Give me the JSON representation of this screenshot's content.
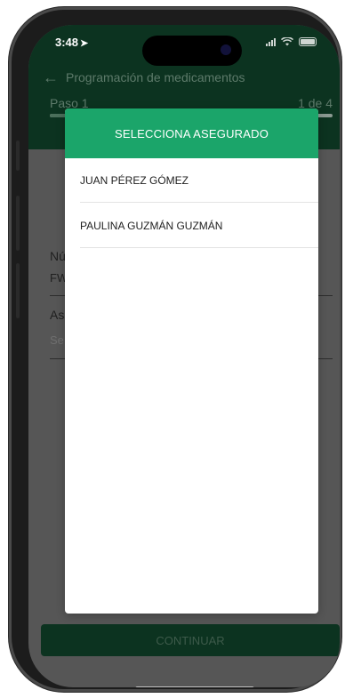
{
  "status_bar": {
    "time": "3:48",
    "location_arrow": "➤"
  },
  "header": {
    "back_icon": "←",
    "title": "Programación de medicamentos"
  },
  "step": {
    "label": "Paso 1",
    "count": "1 de 4",
    "progress_fraction": 0.25
  },
  "form": {
    "policy_label": "Nú",
    "policy_value": "FW",
    "insured_label": "As",
    "insured_placeholder": "Se"
  },
  "modal": {
    "title": "SELECCIONA ASEGURADO",
    "options": [
      {
        "label": "JUAN PÉREZ GÓMEZ"
      },
      {
        "label": "PAULINA GUZMÁN GUZMÁN"
      }
    ]
  },
  "footer": {
    "continue_label": "CONTINUAR"
  },
  "colors": {
    "brand_green": "#1ba56a",
    "dark_green": "#0c3320"
  }
}
